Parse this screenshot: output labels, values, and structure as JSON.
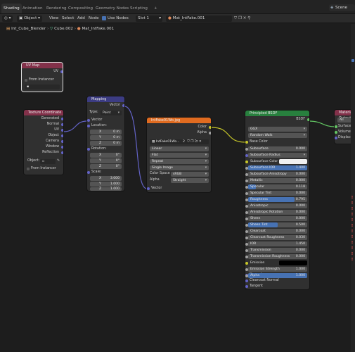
{
  "topbar": {
    "tabs": [
      "Shading",
      "Animation",
      "Rendering",
      "Compositing",
      "Geometry Nodes",
      "Scripting",
      "+"
    ],
    "active_tab": "Shading",
    "scene": "Scene"
  },
  "header": {
    "object_mode": "Object",
    "menu": [
      "View",
      "Select",
      "Add",
      "Node"
    ],
    "use_nodes_label": "Use Nodes",
    "slot": "Slot 1",
    "material": "Mat_IntFake.001"
  },
  "breadcrumb": {
    "object": "Int_Cube_Blender",
    "mesh": "Cube.002",
    "material": "Mat_IntFake.001"
  },
  "uvmap": {
    "title": "UV Map",
    "output": "UV",
    "from_instancer": "From Instancer"
  },
  "texcoord": {
    "title": "Texture Coordinate",
    "outputs": [
      "Generated",
      "Normal",
      "UV",
      "Object",
      "Camera",
      "Window",
      "Reflection"
    ],
    "object_label": "Object:",
    "from_instancer": "From Instancer"
  },
  "mapping": {
    "title": "Mapping",
    "output": "Vector",
    "type_label": "Type:",
    "type_value": "Point",
    "vector_input": "Vector",
    "location_label": "Location:",
    "location": [
      [
        "X",
        "0 m"
      ],
      [
        "Y",
        "0 m"
      ],
      [
        "Z",
        "0 m"
      ]
    ],
    "rotation_label": "Rotation:",
    "rotation": [
      [
        "X",
        "0°"
      ],
      [
        "Y",
        "0°"
      ],
      [
        "Z",
        "0°"
      ]
    ],
    "scale_label": "Scale:",
    "scale": [
      [
        "X",
        "3.000"
      ],
      [
        "Y",
        "1.000"
      ],
      [
        "Z",
        "1.000"
      ]
    ]
  },
  "image": {
    "title": "IntFake01Wo.jpg",
    "out_color": "Color",
    "out_alpha": "Alpha",
    "image_name": "IntFake01Wo...",
    "users": "2",
    "interpolation": "Linear",
    "projection": "Flat",
    "extension": "Repeat",
    "source": "Single Image",
    "color_space_label": "Color Space",
    "color_space": "sRGB",
    "alpha_label": "Alpha",
    "alpha_mode": "Straight",
    "vector_input": "Vector"
  },
  "bsdf": {
    "title": "Principled BSDF",
    "output": "BSDF",
    "distribution": "GGX",
    "subsurface_method": "Random Walk",
    "base_color": "Base Color",
    "params": [
      [
        "Subsurface",
        "0.000",
        "dark"
      ],
      [
        "Subsurface Radius",
        "",
        "dark-dd"
      ],
      [
        "Subsurface Color",
        "",
        "white"
      ],
      [
        "Subsurface IOR",
        "1.400",
        "blue"
      ],
      [
        "Subsurface Anisotropy",
        "0.000",
        "dark"
      ],
      [
        "Metallic",
        "0.000",
        "dark"
      ],
      [
        "Specular",
        "0.118",
        "blue-short"
      ],
      [
        "Specular Tint",
        "0.000",
        "dark"
      ],
      [
        "Roughness",
        "0.795",
        "blue-long"
      ],
      [
        "Anisotropic",
        "0.000",
        "dark"
      ],
      [
        "Anisotropic Rotation",
        "0.000",
        "dark"
      ],
      [
        "Sheen",
        "0.000",
        "dark"
      ],
      [
        "Sheen Tint",
        "0.500",
        "blue-half"
      ],
      [
        "Clearcoat",
        "0.000",
        "dark"
      ],
      [
        "Clearcoat Roughness",
        "0.030",
        "dark"
      ],
      [
        "IOR",
        "1.450",
        "dark"
      ],
      [
        "Transmission",
        "0.000",
        "dark"
      ],
      [
        "Transmission Roughness",
        "0.000",
        "dark"
      ],
      [
        "Emission",
        "",
        "black"
      ],
      [
        "Emission Strength",
        "1.000",
        "dark"
      ],
      [
        "Alpha",
        "1.000",
        "blue"
      ]
    ],
    "inputs_bottom": [
      "Normal",
      "Clearcoat Normal",
      "Tangent"
    ]
  },
  "output": {
    "title": "Material Output",
    "target": "All",
    "inputs": [
      "Surface",
      "Volume",
      "Displacement"
    ]
  },
  "colors": {
    "canvas": "#1d1d1d",
    "node_body": "#303030",
    "header_input": "#83314a",
    "header_vector": "#3c3c83",
    "header_texture": "#e06b20",
    "header_shader": "#28803e",
    "wire_vector": "#6363c7",
    "wire_color": "#c7c729",
    "wire_shader": "#63c763",
    "accent": "#4772b3"
  }
}
